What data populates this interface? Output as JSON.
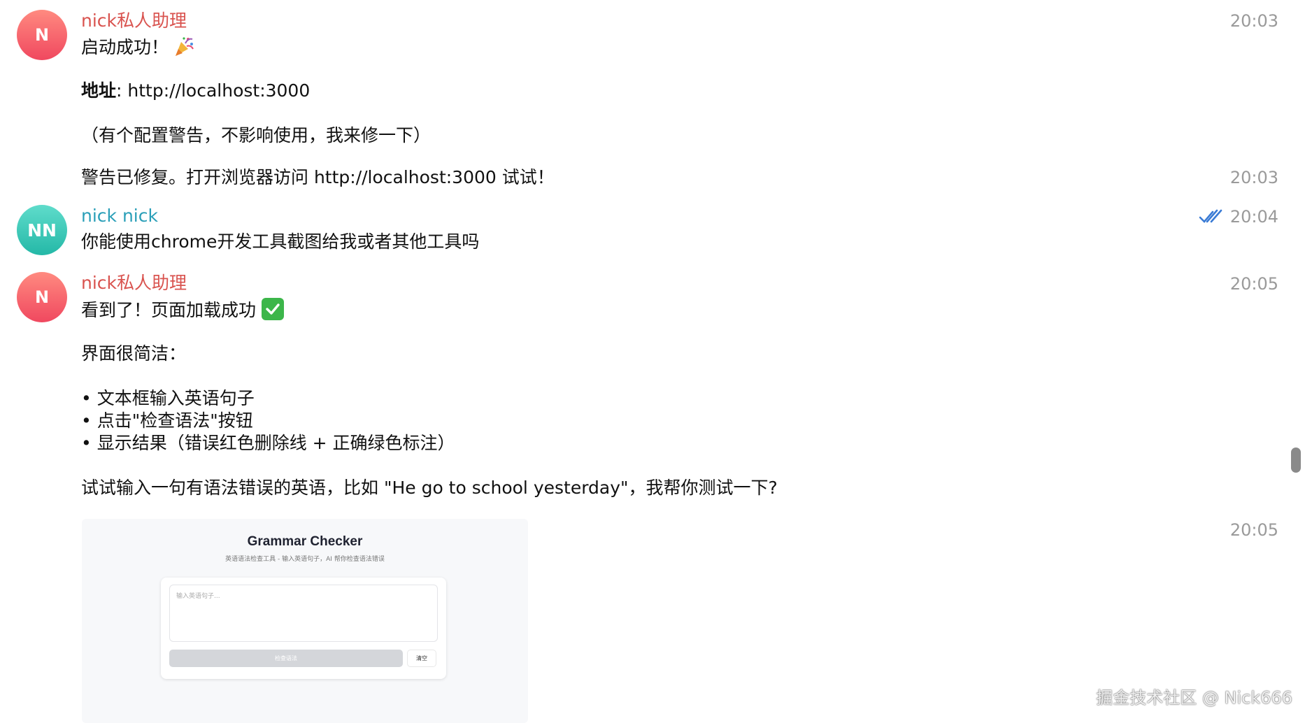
{
  "messages": [
    {
      "avatar": "N",
      "sender": "nick私人助理",
      "time": "20:03",
      "lines": {
        "l1": "启动成功！",
        "l2_bold": "地址",
        "l2_rest": ": http://localhost:3000",
        "l3": "（有个配置警告，不影响使用，我来修一下）",
        "l4": "警告已修复。打开浏览器访问 http://localhost:3000 试试！"
      },
      "time2": "20:03"
    },
    {
      "avatar": "NN",
      "sender": "nick nick",
      "time": "20:04",
      "status_icon": "double-check-icon",
      "lines": {
        "l1": "你能使用chrome开发工具截图给我或者其他工具吗"
      }
    },
    {
      "avatar": "N",
      "sender": "nick私人助理",
      "time": "20:05",
      "lines": {
        "l1": "看到了！页面加载成功",
        "l2": "界面很简洁：",
        "b1": "• 文本框输入英语句子",
        "b2": "• 点击\"检查语法\"按钮",
        "b3": "• 显示结果（错误红色删除线 + 正确绿色标注）",
        "l3": "试试输入一句有语法错误的英语，比如 \"He go to school yesterday\"，我帮你测试一下?"
      },
      "time2": "20:05"
    }
  ],
  "screenshot": {
    "title": "Grammar Checker",
    "subtitle": "英语语法检查工具 - 输入英语句子，AI 帮你检查语法错误",
    "placeholder": "输入英语句子...",
    "check_button": "检查语法",
    "clear_button": "清空"
  },
  "watermark": "掘金技术社区 @ Nick666",
  "colors": {
    "assistant_name": "#d9534f",
    "user_name": "#2a9fb8",
    "timestamp": "#9a9a9a",
    "read_check": "#3a7bd5"
  }
}
